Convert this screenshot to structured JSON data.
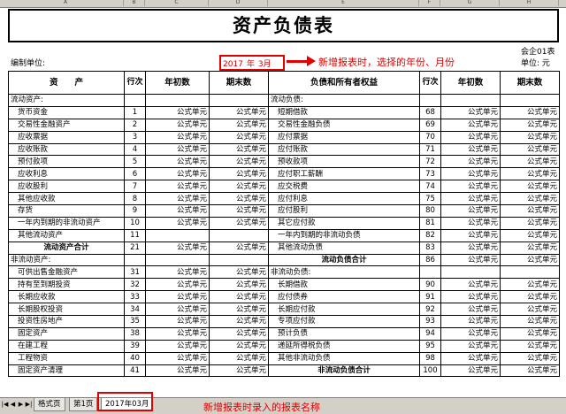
{
  "columns": [
    "A",
    "B",
    "C",
    "D",
    "E",
    "F",
    "G",
    "H"
  ],
  "title": "资产负债表",
  "form_code": "会企01表",
  "org_label": "编制单位:",
  "unit_label": "单位: 元",
  "period": {
    "year": "2017",
    "year_suffix": "年",
    "month": "3月"
  },
  "annotations": {
    "top": "新增报表时，选择的年份、月份",
    "bottom": "新增报表时录入的报表名称"
  },
  "headers": [
    "资　　产",
    "行次",
    "年初数",
    "期末数",
    "负债和所有者权益",
    "行次",
    "年初数",
    "期末数"
  ],
  "rows": [
    {
      "a": "流动资产:",
      "b": "",
      "c": "",
      "d": "",
      "e": "流动负债:",
      "f": "",
      "g": "",
      "h": "",
      "ta": "sec",
      "te": "sec"
    },
    {
      "a": "货币资金",
      "b": "1",
      "c": "公式单元",
      "d": "公式单元",
      "e": "短期借款",
      "f": "68",
      "g": "公式单元",
      "h": "公式单元"
    },
    {
      "a": "交易性金融资产",
      "b": "2",
      "c": "公式单元",
      "d": "公式单元",
      "e": "交易性金融负债",
      "f": "69",
      "g": "公式单元",
      "h": "公式单元"
    },
    {
      "a": "应收票据",
      "b": "3",
      "c": "公式单元",
      "d": "公式单元",
      "e": "应付票据",
      "f": "70",
      "g": "公式单元",
      "h": "公式单元"
    },
    {
      "a": "应收账款",
      "b": "4",
      "c": "公式单元",
      "d": "公式单元",
      "e": "应付账款",
      "f": "71",
      "g": "公式单元",
      "h": "公式单元"
    },
    {
      "a": "预付款项",
      "b": "5",
      "c": "公式单元",
      "d": "公式单元",
      "e": "预收款项",
      "f": "72",
      "g": "公式单元",
      "h": "公式单元"
    },
    {
      "a": "应收利息",
      "b": "6",
      "c": "公式单元",
      "d": "公式单元",
      "e": "应付职工薪酬",
      "f": "73",
      "g": "公式单元",
      "h": "公式单元"
    },
    {
      "a": "应收股利",
      "b": "7",
      "c": "公式单元",
      "d": "公式单元",
      "e": "应交税费",
      "f": "74",
      "g": "公式单元",
      "h": "公式单元"
    },
    {
      "a": "其他应收款",
      "b": "8",
      "c": "公式单元",
      "d": "公式单元",
      "e": "应付利息",
      "f": "75",
      "g": "公式单元",
      "h": "公式单元"
    },
    {
      "a": "存货",
      "b": "9",
      "c": "公式单元",
      "d": "公式单元",
      "e": "应付股利",
      "f": "80",
      "g": "公式单元",
      "h": "公式单元"
    },
    {
      "a": "一年内到期的非流动资产",
      "b": "10",
      "c": "公式单元",
      "d": "公式单元",
      "e": "其它应付款",
      "f": "81",
      "g": "公式单元",
      "h": "公式单元"
    },
    {
      "a": "其他流动资产",
      "b": "11",
      "c": "",
      "d": "",
      "e": "一年内到期的非流动负债",
      "f": "82",
      "g": "公式单元",
      "h": "公式单元"
    },
    {
      "a": "流动资产合计",
      "b": "21",
      "c": "公式单元",
      "d": "公式单元",
      "e": "其他流动负债",
      "f": "83",
      "g": "公式单元",
      "h": "公式单元",
      "ta": "total"
    },
    {
      "a": "非流动资产:",
      "b": "",
      "c": "",
      "d": "",
      "e": "流动负债合计",
      "f": "86",
      "g": "公式单元",
      "h": "公式单元",
      "ta": "sec",
      "te": "total"
    },
    {
      "a": "可供出售金融资产",
      "b": "31",
      "c": "公式单元",
      "d": "公式单元",
      "e": "非流动负债:",
      "f": "",
      "g": "",
      "h": "",
      "te": "sec"
    },
    {
      "a": "持有至到期投资",
      "b": "32",
      "c": "公式单元",
      "d": "公式单元",
      "e": "长期借款",
      "f": "90",
      "g": "公式单元",
      "h": "公式单元"
    },
    {
      "a": "长期应收款",
      "b": "33",
      "c": "公式单元",
      "d": "公式单元",
      "e": "应付债券",
      "f": "91",
      "g": "公式单元",
      "h": "公式单元"
    },
    {
      "a": "长期股权投资",
      "b": "34",
      "c": "公式单元",
      "d": "公式单元",
      "e": "长期应付款",
      "f": "92",
      "g": "公式单元",
      "h": "公式单元"
    },
    {
      "a": "投资性房地产",
      "b": "35",
      "c": "公式单元",
      "d": "公式单元",
      "e": "专项应付款",
      "f": "93",
      "g": "公式单元",
      "h": "公式单元"
    },
    {
      "a": "固定资产",
      "b": "38",
      "c": "公式单元",
      "d": "公式单元",
      "e": "预计负债",
      "f": "94",
      "g": "公式单元",
      "h": "公式单元"
    },
    {
      "a": "在建工程",
      "b": "39",
      "c": "公式单元",
      "d": "公式单元",
      "e": "递延所得税负债",
      "f": "95",
      "g": "公式单元",
      "h": "公式单元"
    },
    {
      "a": "工程物资",
      "b": "40",
      "c": "公式单元",
      "d": "公式单元",
      "e": "其他非流动负债",
      "f": "98",
      "g": "公式单元",
      "h": "公式单元"
    },
    {
      "a": "固定资产清理",
      "b": "41",
      "c": "公式单元",
      "d": "公式单元",
      "e": "非流动负债合计",
      "f": "100",
      "g": "公式单元",
      "h": "公式单元",
      "te": "total"
    }
  ],
  "tabs": [
    "格式页",
    "第1页",
    "2017年03月"
  ],
  "nav_icons": [
    "first-sheet-icon",
    "prev-sheet-icon",
    "next-sheet-icon",
    "last-sheet-icon"
  ],
  "colors": {
    "annotation": "#e00000",
    "chrome": "#d4d0c8"
  }
}
